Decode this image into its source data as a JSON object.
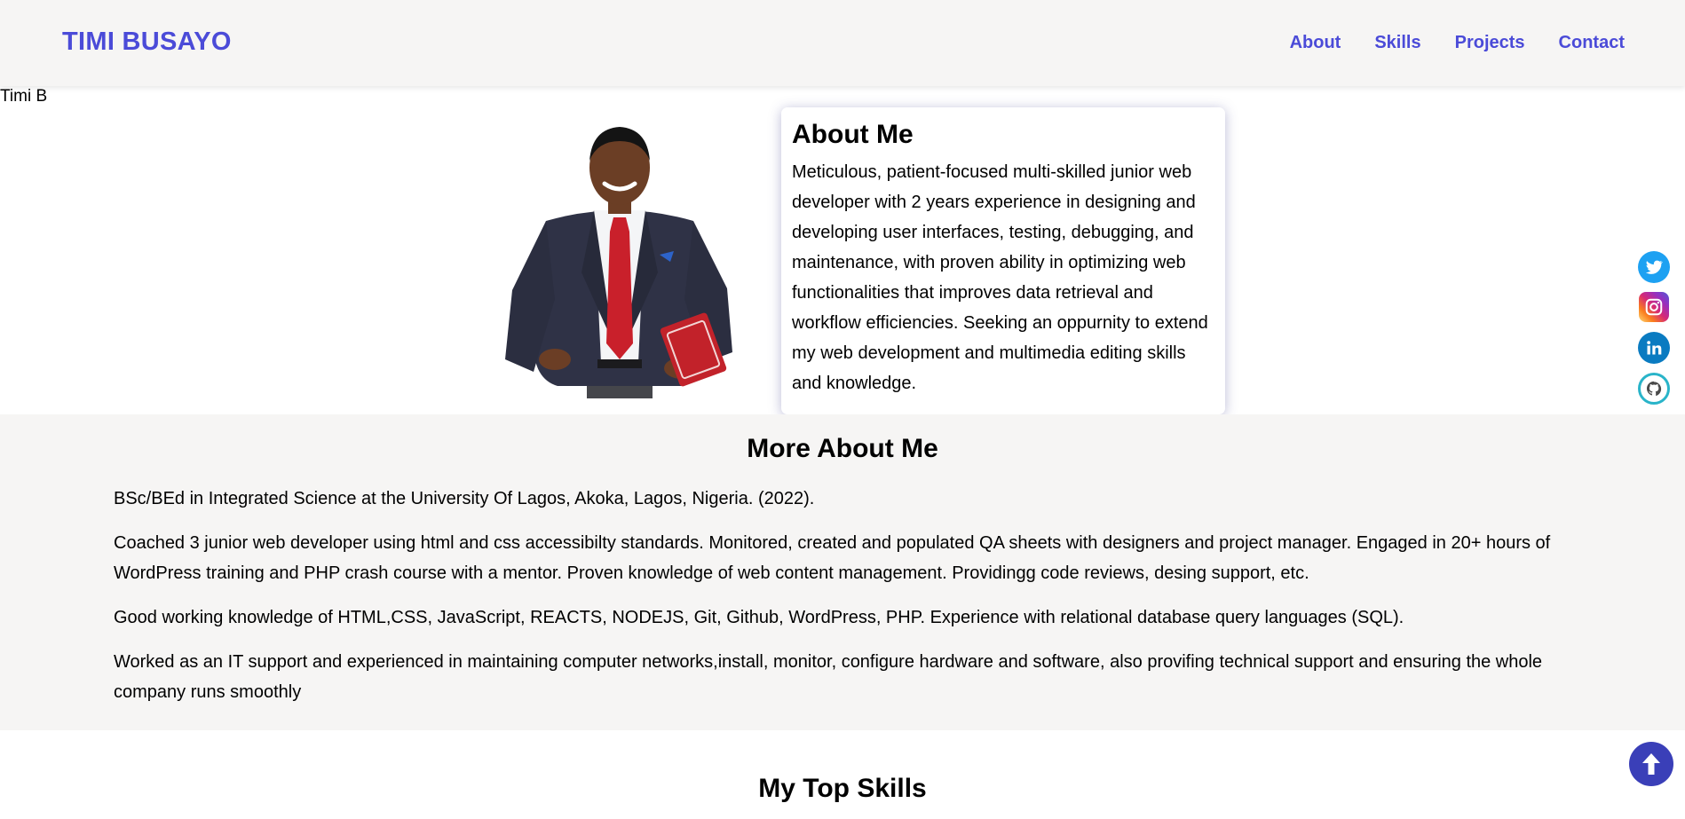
{
  "header": {
    "brand": "TIMI BUSAYO",
    "nav": [
      "About",
      "Skills",
      "Projects",
      "Contact"
    ]
  },
  "hero": {
    "image_alt": "Timi B",
    "about": {
      "title": "About Me",
      "text": "Meticulous, patient-focused multi-skilled junior web developer with 2 years experience in designing and developing user interfaces, testing, debugging, and maintenance, with proven ability in optimizing web functionalities that improves data retrieval and workflow efficiencies. Seeking an oppurnity to extend my web development and multimedia editing skills and knowledge."
    }
  },
  "social": [
    "twitter-icon",
    "instagram-icon",
    "linkedin-icon",
    "github-icon"
  ],
  "more_about": {
    "title": "More About Me",
    "paragraphs": [
      "BSc/BEd in Integrated Science at the University Of Lagos, Akoka, Lagos, Nigeria. (2022).",
      "Coached 3 junior web developer using html and css accessibilty standards. Monitored, created and populated QA sheets with designers and project manager. Engaged in 20+ hours of WordPress training and PHP crash course with a mentor. Proven knowledge of web content management. Providingg code reviews, desing support, etc.",
      "Good working knowledge of HTML,CSS, JavaScript, REACTS, NODEJS, Git, Github, WordPress, PHP. Experience with relational database query languages (SQL).",
      "Worked as an IT support and experienced in maintaining computer networks,install, monitor, configure hardware and software, also provifing technical support and ensuring the whole company runs smoothly"
    ]
  },
  "skills": {
    "title": "My Top Skills"
  },
  "colors": {
    "brand": "#4b4bd8",
    "band": "#f6f5f4",
    "back_to_top": "#3a3fb8"
  }
}
